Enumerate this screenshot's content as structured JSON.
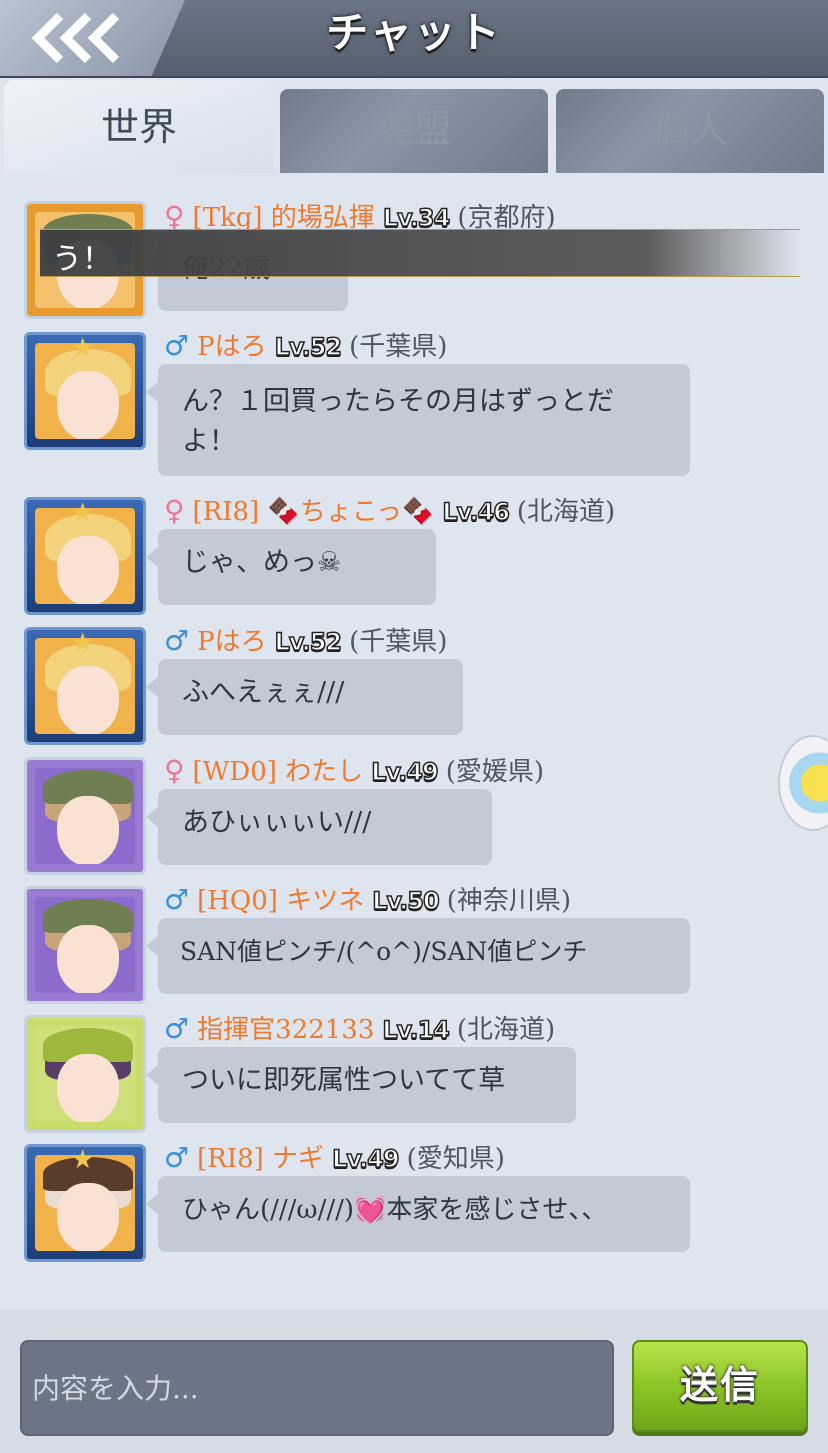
{
  "header": {
    "title": "チャット",
    "back_icon": "triple-chevron-left-icon"
  },
  "tabs": [
    {
      "label": "世界",
      "active": true
    },
    {
      "label": "連盟",
      "active": false
    },
    {
      "label": "個人",
      "active": false
    }
  ],
  "overlay_banner": {
    "text": "う！"
  },
  "messages": [
    {
      "gender": "♀",
      "name": "[Tkg] 的場弘揮",
      "level": "Lv.34",
      "prefecture": "(京都府)",
      "text": "俺22歳"
    },
    {
      "gender": "♂",
      "name": "Pはろ",
      "level": "Lv.52",
      "prefecture": "(千葉県)",
      "text": "ん？１回買ったらその月はずっとだよ！"
    },
    {
      "gender": "♀",
      "name": "[RI8] 🍫ちょこっ🍫",
      "level": "Lv.46",
      "prefecture": "(北海道)",
      "text": "じゃ、めっ☠"
    },
    {
      "gender": "♂",
      "name": "Pはろ",
      "level": "Lv.52",
      "prefecture": "(千葉県)",
      "text": "ふへえぇぇ///"
    },
    {
      "gender": "♀",
      "name": "[WD0] わたし",
      "level": "Lv.49",
      "prefecture": "(愛媛県)",
      "text": "あひぃぃぃい///"
    },
    {
      "gender": "♂",
      "name": "[HQ0] キツネ",
      "level": "Lv.50",
      "prefecture": "(神奈川県)",
      "text": "SAN値ピンチ/(^o^)/SAN値ピンチ"
    },
    {
      "gender": "♂",
      "name": "指揮官322133",
      "level": "Lv.14",
      "prefecture": "(北海道)",
      "text": "ついに即死属性ついてて草"
    },
    {
      "gender": "♂",
      "name": "[RI8] ナギ",
      "level": "Lv.49",
      "prefecture": "(愛知県)",
      "text": "ひゃん(///ω///)💓本家を感じさせ、、"
    }
  ],
  "composer": {
    "placeholder": "内容を入力...",
    "send_label": "送信"
  },
  "colors": {
    "name": "#ef7a2e",
    "female": "#f27591",
    "male": "#3c8fd9",
    "send": "#88c224"
  }
}
